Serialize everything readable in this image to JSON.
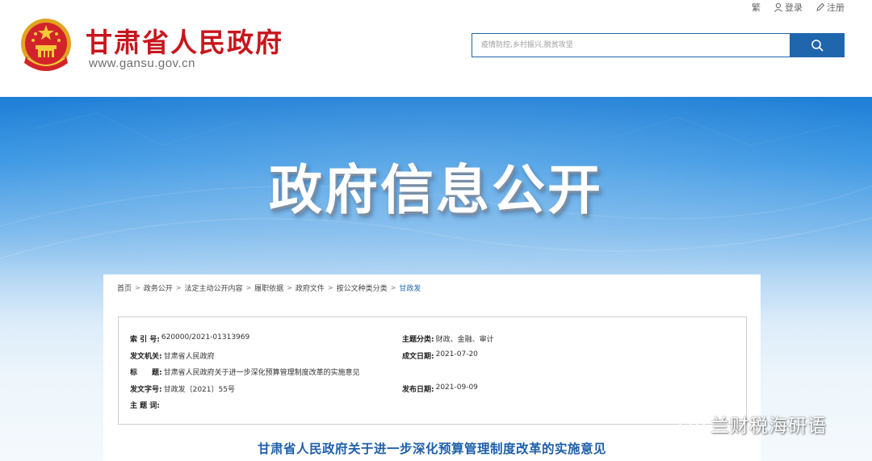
{
  "header": {
    "site_title": "甘肃省人民政府",
    "site_url": "www.gansu.gov.cn",
    "top_links": {
      "traditional": "繁",
      "login": "登录",
      "register": "注册"
    },
    "search": {
      "placeholder": "疫情防控,乡村振兴,脱贫攻坚"
    }
  },
  "banner": {
    "title": "政府信息公开"
  },
  "breadcrumb": [
    "首页",
    "政务公开",
    "法定主动公开内容",
    "履职依据",
    "政府文件",
    "按公文种类分类",
    "甘政发"
  ],
  "meta": {
    "index_no": {
      "label": "索 引 号:",
      "value": "620000/2021-01313969"
    },
    "topic": {
      "label": "主题分类:",
      "value": "财政、金融、审计"
    },
    "issuer": {
      "label": "发文机关:",
      "value": "甘肃省人民政府"
    },
    "created": {
      "label": "成文日期:",
      "value": "2021-07-20"
    },
    "title": {
      "label": "标　　题:",
      "value": "甘肃省人民政府关于进一步深化预算管理制度改革的实施意见"
    },
    "doc_no": {
      "label": "发文字号:",
      "value": "甘政发〔2021〕55号"
    },
    "published": {
      "label": "发布日期:",
      "value": "2021-09-09"
    },
    "keywords": {
      "label": "主 题 词:",
      "value": ""
    }
  },
  "document": {
    "title": "甘肃省人民政府关于进一步深化预算管理制度改革的实施意见"
  },
  "watermark": {
    "text": "兰财税海研语"
  },
  "colors": {
    "brand_red": "#c8161d",
    "brand_blue": "#1f66ad",
    "title_blue": "#1f5fa8"
  }
}
